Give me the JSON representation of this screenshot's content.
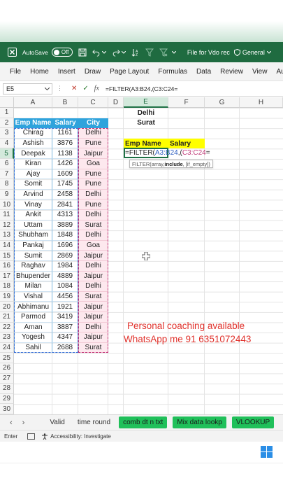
{
  "titlebar": {
    "autosave_label": "AutoSave",
    "autosave_state": "Off",
    "file_title": "File for Vdo rec",
    "sensitivity": "General"
  },
  "ribbon": {
    "tabs": [
      "File",
      "Home",
      "Insert",
      "Draw",
      "Page Layout",
      "Formulas",
      "Data",
      "Review",
      "View",
      "Auto"
    ]
  },
  "formula_bar": {
    "name_box": "E5",
    "fx_label": "fx",
    "formula": "=FILTER(A3:B24,(C3:C24="
  },
  "grid": {
    "columns": [
      "A",
      "B",
      "C",
      "D",
      "E",
      "F",
      "G",
      "H"
    ],
    "rows": [
      "1",
      "2",
      "3",
      "4",
      "5",
      "6",
      "7",
      "8",
      "9",
      "10",
      "11",
      "12",
      "13",
      "14",
      "15",
      "16",
      "17",
      "18",
      "19",
      "20",
      "21",
      "22",
      "23",
      "24",
      "25",
      "26",
      "27",
      "28",
      "29",
      "30"
    ],
    "selected_column": "E",
    "selected_row": "5",
    "table_headers": {
      "name": "Emp Name",
      "salary": "Salary",
      "city": "City"
    },
    "employees": [
      {
        "name": "Chirag",
        "salary": "1161",
        "city": "Delhi"
      },
      {
        "name": "Ashish",
        "salary": "3876",
        "city": "Pune"
      },
      {
        "name": "Deepak",
        "salary": "1138",
        "city": "Jaipur"
      },
      {
        "name": "Kiran",
        "salary": "1426",
        "city": "Goa"
      },
      {
        "name": "Ajay",
        "salary": "1609",
        "city": "Pune"
      },
      {
        "name": "Somit",
        "salary": "1745",
        "city": "Pune"
      },
      {
        "name": "Arvind",
        "salary": "2458",
        "city": "Delhi"
      },
      {
        "name": "Vinay",
        "salary": "2841",
        "city": "Pune"
      },
      {
        "name": "Ankit",
        "salary": "4313",
        "city": "Delhi"
      },
      {
        "name": "Uttam",
        "salary": "3889",
        "city": "Surat"
      },
      {
        "name": "Shubham",
        "salary": "1848",
        "city": "Delhi"
      },
      {
        "name": "Pankaj",
        "salary": "1696",
        "city": "Goa"
      },
      {
        "name": "Sumit",
        "salary": "2869",
        "city": "Jaipur"
      },
      {
        "name": "Raghav",
        "salary": "1984",
        "city": "Delhi"
      },
      {
        "name": "Bhupender",
        "salary": "4889",
        "city": "Jaipur"
      },
      {
        "name": "Milan",
        "salary": "1084",
        "city": "Delhi"
      },
      {
        "name": "Vishal",
        "salary": "4456",
        "city": "Surat"
      },
      {
        "name": "Abhimanu",
        "salary": "1921",
        "city": "Jaipur"
      },
      {
        "name": "Parmod",
        "salary": "3419",
        "label_city": "",
        "city": "Jaipur"
      },
      {
        "name": "Aman",
        "salary": "3887",
        "city": "Delhi"
      },
      {
        "name": "Yogesh",
        "salary": "4347",
        "city": "Jaipur"
      },
      {
        "name": "Sahil",
        "salary": "2688",
        "city": "Surat"
      }
    ],
    "criteria": [
      "Delhi",
      "Surat"
    ],
    "output_headers": {
      "name": "Emp Name",
      "salary": "Salary"
    },
    "editing_formula": {
      "prefix": "=FILTER(",
      "range_b": "A3:B24",
      "comma": ",(",
      "range_c": "C3:C24",
      "suffix": "="
    },
    "tooltip": {
      "func": "FILTER(array, ",
      "bold": "include",
      "rest": ", [if_empty])"
    }
  },
  "overlay": {
    "line1": "Personal coaching available",
    "line2": "WhatsApp me 91 6351072443",
    "color": "#e0312b"
  },
  "sheet_tabs": {
    "tabs": [
      "Valid",
      "time round"
    ],
    "green_tabs": [
      "comb dt n txt",
      "Mix data lookp",
      "VLOOKUP"
    ]
  },
  "status_bar": {
    "mode": "Enter",
    "accessibility": "Accessibility: Investigate"
  },
  "colors": {
    "excel_green": "#1f6b40",
    "header_blue": "#2fa3dc",
    "highlight_yellow": "#ffff00",
    "tab_green": "#20c05a"
  }
}
